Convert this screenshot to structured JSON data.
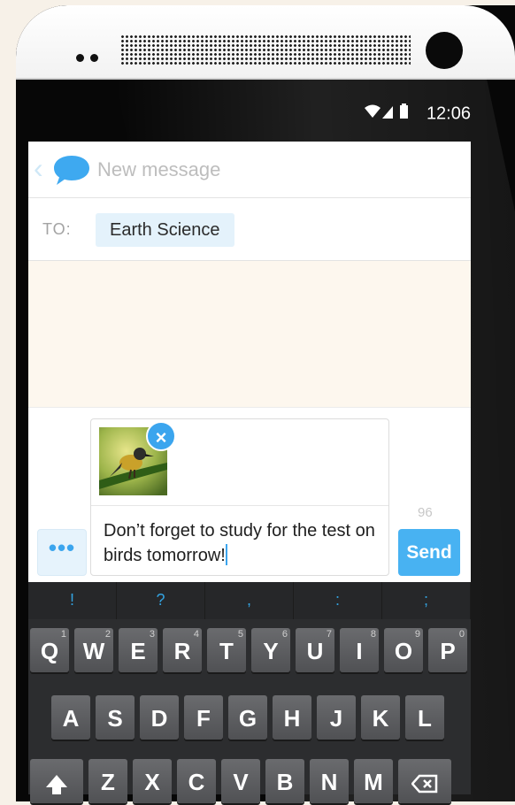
{
  "status_bar": {
    "time": "12:06",
    "icons": [
      "wifi-icon",
      "signal-icon",
      "battery-icon"
    ]
  },
  "header": {
    "title": "New message"
  },
  "recipient": {
    "label": "TO:",
    "name": "Earth Science"
  },
  "compose": {
    "message": "Don’t forget to study for the test on birds tomorrow!",
    "char_count": "96",
    "more_label": "•••",
    "send_label": "Send",
    "remove_symbol": "×"
  },
  "keyboard": {
    "symbols": [
      "!",
      "?",
      ",",
      ":",
      ";"
    ],
    "rows": [
      [
        {
          "k": "Q",
          "n": "1"
        },
        {
          "k": "W",
          "n": "2"
        },
        {
          "k": "E",
          "n": "3"
        },
        {
          "k": "R",
          "n": "4"
        },
        {
          "k": "T",
          "n": "5"
        },
        {
          "k": "Y",
          "n": "6"
        },
        {
          "k": "U",
          "n": "7"
        },
        {
          "k": "I",
          "n": "8"
        },
        {
          "k": "O",
          "n": "9"
        },
        {
          "k": "P",
          "n": "0"
        }
      ],
      [
        {
          "k": "A"
        },
        {
          "k": "S"
        },
        {
          "k": "D"
        },
        {
          "k": "F"
        },
        {
          "k": "G"
        },
        {
          "k": "H"
        },
        {
          "k": "J"
        },
        {
          "k": "K"
        },
        {
          "k": "L"
        }
      ],
      [
        {
          "k": "Z"
        },
        {
          "k": "X"
        },
        {
          "k": "C"
        },
        {
          "k": "V"
        },
        {
          "k": "B"
        },
        {
          "k": "N"
        },
        {
          "k": "M"
        }
      ]
    ]
  },
  "colors": {
    "accent": "#48b2f2",
    "chip": "#e4f2fb",
    "background": "#f7f1e8"
  }
}
